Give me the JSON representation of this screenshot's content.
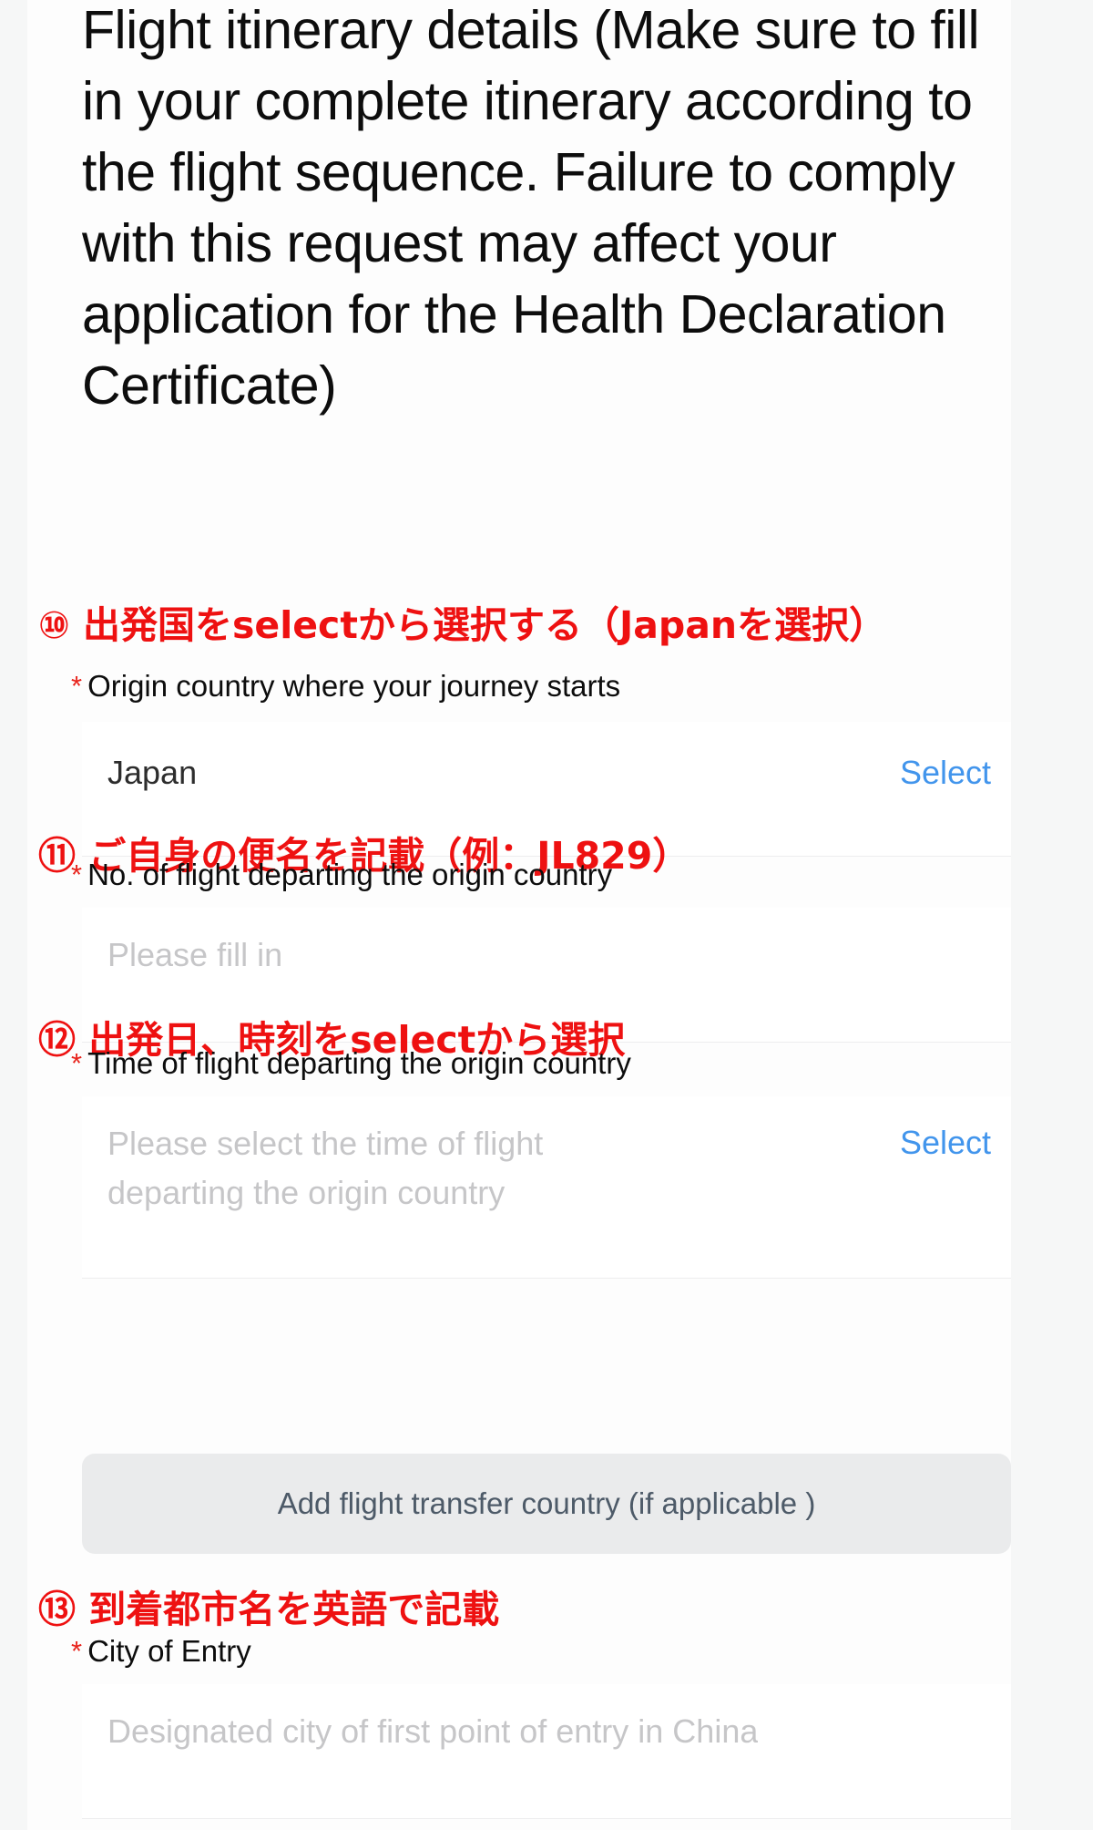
{
  "section": {
    "title": "Flight itinerary details (Make sure to fill in your complete itinerary according to the flight sequence. Failure to comply with this request may affect your application for the Health Declaration Certificate)"
  },
  "annotations": {
    "a10": "⑩ 出発国をselectから選択する（Japanを選択）",
    "a11": "⑪ ご自身の便名を記載（例：JL829）",
    "a12": "⑫ 出発日、時刻をselectから選択",
    "a13": "⑬ 到着都市名を英語で記載"
  },
  "fields": {
    "origin_country": {
      "required_mark": "*",
      "label": "Origin country where your journey starts",
      "value": "Japan",
      "action_label": "Select"
    },
    "flight_number": {
      "required_mark": "*",
      "label": "No. of flight departing the origin country",
      "value": "",
      "placeholder": "Please fill in"
    },
    "flight_time": {
      "required_mark": "*",
      "label": "Time of flight departing the origin country",
      "value": "",
      "placeholder": "Please select the time of flight departing the origin country",
      "action_label": "Select"
    },
    "city_of_entry": {
      "required_mark": "*",
      "label": "City of Entry",
      "value": "",
      "placeholder": "Designated city of first point of entry in China"
    }
  },
  "buttons": {
    "add_transfer": "Add flight transfer country (if applicable )"
  },
  "colors": {
    "annotation_red": "#ee1111",
    "required_star_red": "#e8231c",
    "link_blue": "#4295ec",
    "placeholder_gray": "#c6c6c8",
    "button_bg": "#eaebec",
    "button_text": "#4d5a68"
  }
}
